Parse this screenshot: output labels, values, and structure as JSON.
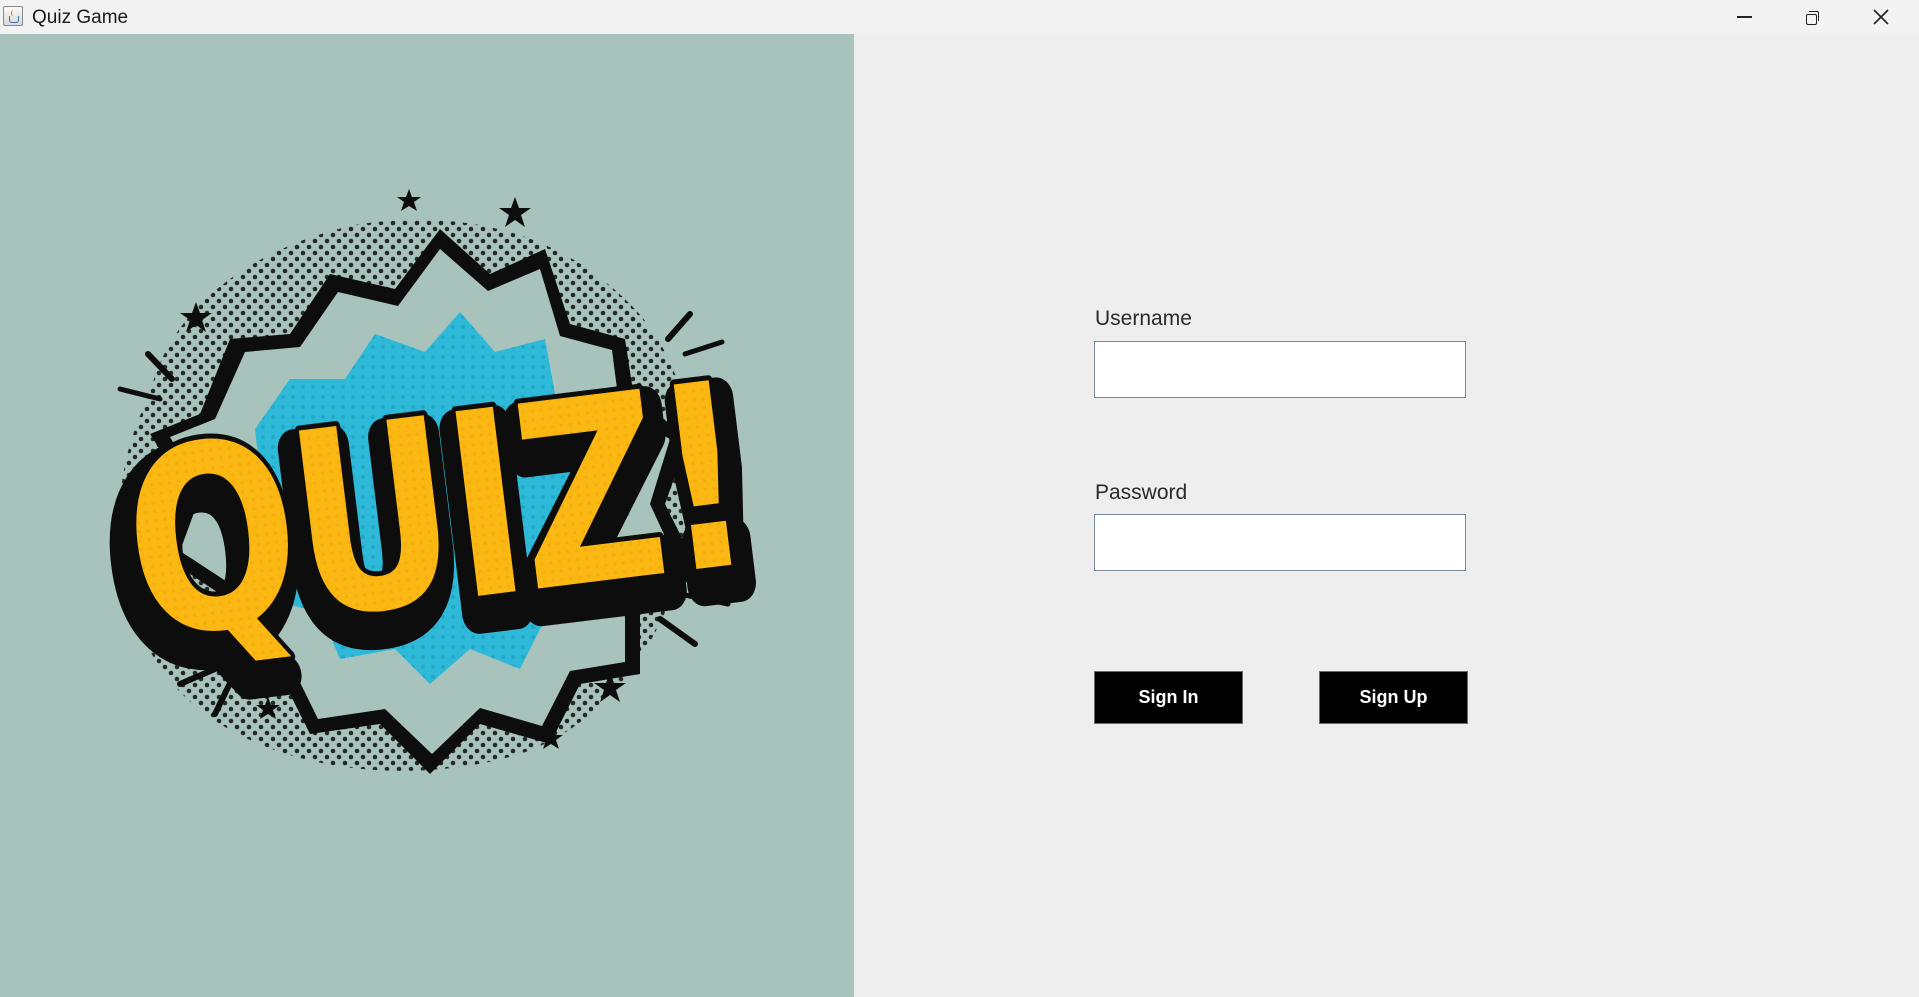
{
  "window": {
    "title": "Quiz Game",
    "controls": [
      "minimize",
      "restore",
      "close"
    ]
  },
  "logo": {
    "text": "QUIZ!",
    "colors": {
      "panel_background": "#a7c3bb",
      "letters": "#fbb812",
      "letter_shadow": "#e9960a",
      "burst": "#2eb9d8",
      "outline": "#0d0d0d"
    }
  },
  "form": {
    "username": {
      "label": "Username",
      "value": "",
      "placeholder": ""
    },
    "password": {
      "label": "Password",
      "value": "",
      "placeholder": ""
    },
    "buttons": {
      "sign_in": "Sign In",
      "sign_up": "Sign Up"
    }
  },
  "colors": {
    "form_background": "#eeeeee",
    "button_background": "#000000",
    "button_text": "#ffffff"
  }
}
